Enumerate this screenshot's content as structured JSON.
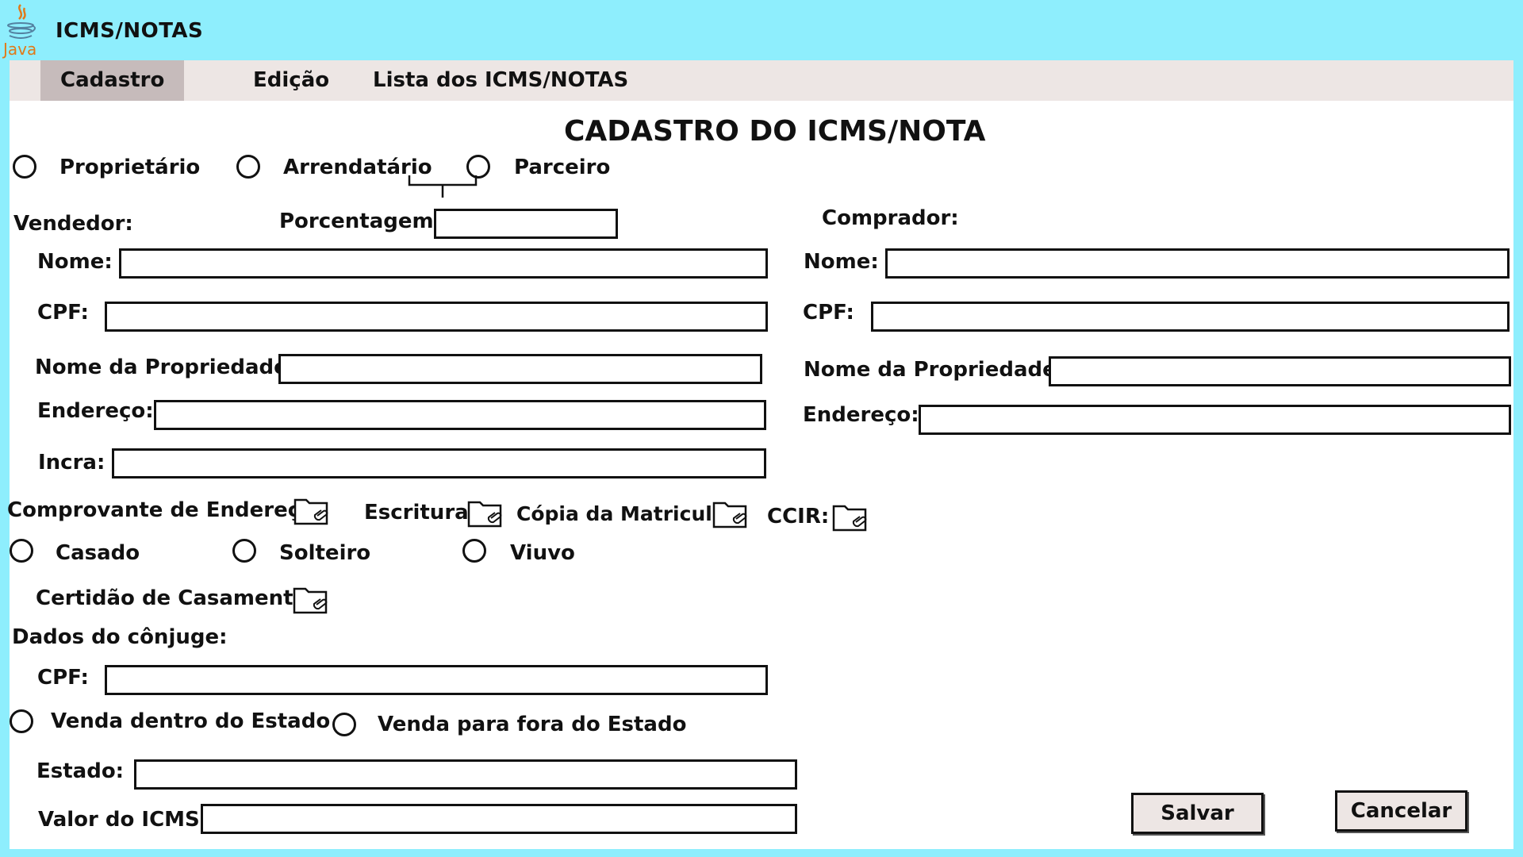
{
  "app": {
    "title": "ICMS/NOTAS",
    "logo_text": "Java"
  },
  "tabs": [
    {
      "label": "Cadastro",
      "active": true
    },
    {
      "label": "Edição",
      "active": false
    },
    {
      "label": "Lista dos ICMS/NOTAS",
      "active": false
    }
  ],
  "form": {
    "title": "CADASTRO DO ICMS/NOTA",
    "role_options": [
      "Proprietário",
      "Arrendatário",
      "Parceiro"
    ],
    "percentage_label": "Porcentagem:",
    "seller": {
      "heading": "Vendedor:",
      "name_label": "Nome:",
      "cpf_label": "CPF:",
      "property_label": "Nome da Propriedade:",
      "address_label": "Endereço:",
      "incra_label": "Incra:"
    },
    "buyer": {
      "heading": "Comprador:",
      "name_label": "Nome:",
      "cpf_label": "CPF:",
      "property_label": "Nome da Propriedade:",
      "address_label": "Endereço:"
    },
    "documents": {
      "address_proof": "Comprovante de Endereço:",
      "deed": "Escritura:",
      "registry_copy": "Cópia da Matricula:",
      "ccir": "CCIR:"
    },
    "marital_options": [
      "Casado",
      "Solteiro",
      "Viuvo"
    ],
    "marriage_cert_label": "Certidão de Casamento:",
    "spouse": {
      "heading": "Dados do cônjuge:",
      "cpf_label": "CPF:"
    },
    "sale_options": [
      "Venda dentro do Estado",
      "Venda para fora do Estado"
    ],
    "state_label": "Estado:",
    "icms_label": "Valor do ICMS:",
    "save_label": "Salvar",
    "cancel_label": "Cancelar"
  },
  "icons": {
    "logo": "java-coffee-icon",
    "attach": "folder-attachment-icon"
  },
  "colors": {
    "window_bg": "#8eeefd",
    "tabbar_bg": "#ede6e4",
    "active_tab_bg": "#c6bbbb",
    "logo_orange": "#e07a1a",
    "logo_blue": "#5382a1"
  }
}
